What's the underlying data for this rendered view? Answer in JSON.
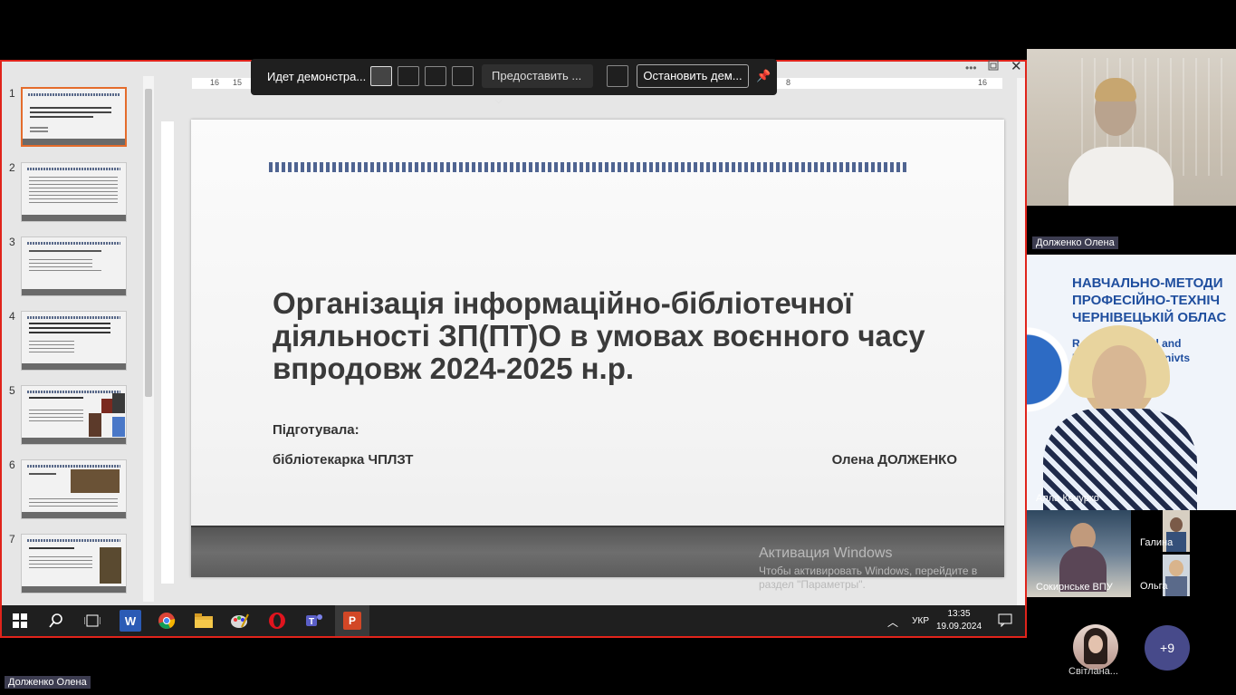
{
  "share_toolbar": {
    "sharing_label": "Идет демонстра...",
    "provide_label": "Предоставить ...",
    "stop_label": "Остановить дем..."
  },
  "powerpoint": {
    "ruler_numbers": [
      "16",
      "15",
      "8",
      "16"
    ],
    "thumbnails": [
      {
        "num": "1",
        "active": true
      },
      {
        "num": "2"
      },
      {
        "num": "3"
      },
      {
        "num": "4"
      },
      {
        "num": "5"
      },
      {
        "num": "6"
      },
      {
        "num": "7"
      }
    ],
    "slide": {
      "title": "Організація інформаційно-бібліотечної діяльності ЗП(ПТ)О в умовах воєнного часу впродовж 2024-2025 н.р.",
      "prepared_label": "Підготувала:",
      "role": "бібліотекарка ЧПЛЗТ",
      "author": "Олена ДОЛЖЕНКО"
    },
    "activation_title": "Активация Windows",
    "activation_text": "Чтобы активировать Windows, перейдите в раздел \"Параметры\"."
  },
  "taskbar": {
    "lang": "УКР",
    "time": "13:35",
    "date": "19.09.2024"
  },
  "participants": {
    "speaker_name": "Долженко Олена",
    "banner_line1": "НАВЧАЛЬНО-МЕТОДИ",
    "banner_line2": "ПРОФЕСІЙНО-ТЕХНІЧ",
    "banner_line3": "ЧЕРНІВЕЦЬКІЙ ОБЛАС",
    "banner_en1": "R... for Technical and",
    "banner_en2": "E... Training, Chernivts",
    "second_name": "Алла Кочурко",
    "third_name": "Сокирнське ВПУ",
    "fourth_name": "Галина",
    "fifth_name": "Ольга",
    "avatar_name": "Світлана...",
    "more_count": "+9",
    "presenter_tag": "Долженко Олена"
  },
  "colors": {
    "share_border": "#e0241b",
    "slide_stripe": "#4f6491",
    "more_badge": "#474a8a"
  }
}
